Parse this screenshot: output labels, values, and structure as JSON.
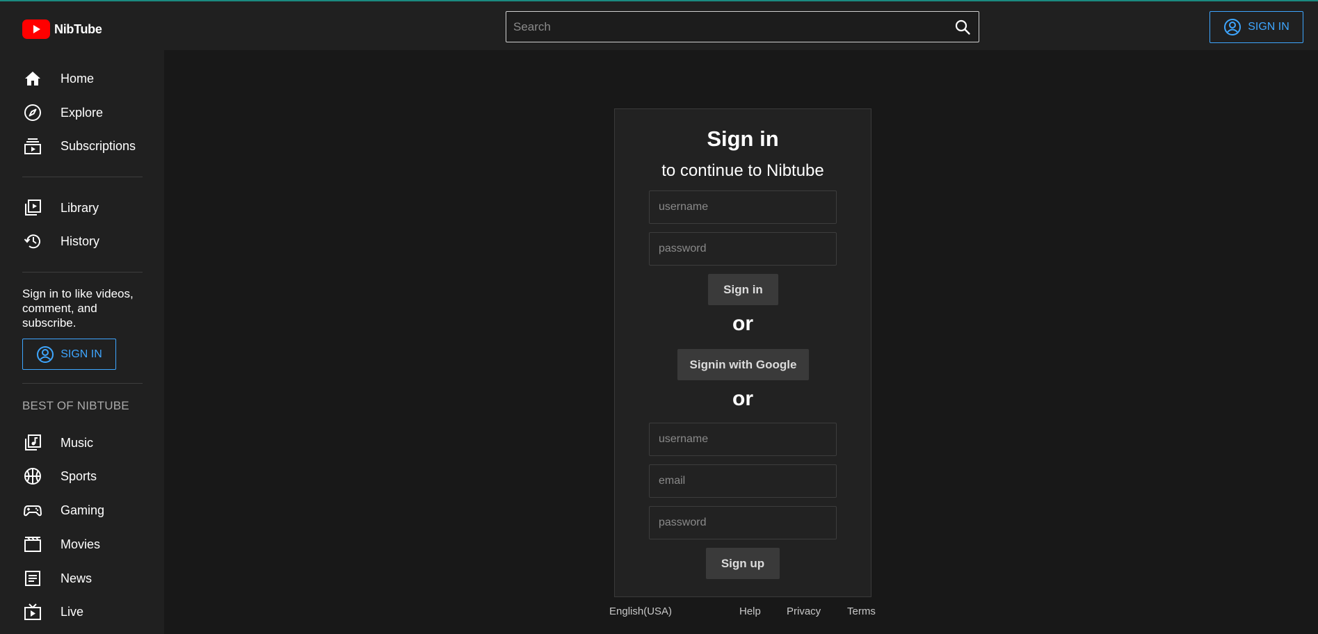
{
  "app": {
    "name": "NibTube"
  },
  "header": {
    "search_placeholder": "Search",
    "signin_label": "SIGN IN"
  },
  "sidebar": {
    "primary": [
      {
        "label": "Home",
        "icon": "home-icon"
      },
      {
        "label": "Explore",
        "icon": "compass-icon"
      },
      {
        "label": "Subscriptions",
        "icon": "subscriptions-icon"
      }
    ],
    "secondary": [
      {
        "label": "Library",
        "icon": "library-icon"
      },
      {
        "label": "History",
        "icon": "history-icon"
      }
    ],
    "signin_message": "Sign in to like videos, comment, and subscribe.",
    "signin_label": "SIGN IN",
    "section_title": "BEST OF NIBTUBE",
    "best": [
      {
        "label": "Music",
        "icon": "music-icon"
      },
      {
        "label": "Sports",
        "icon": "sports-icon"
      },
      {
        "label": "Gaming",
        "icon": "gaming-icon"
      },
      {
        "label": "Movies",
        "icon": "movies-icon"
      },
      {
        "label": "News",
        "icon": "news-icon"
      },
      {
        "label": "Live",
        "icon": "live-icon"
      }
    ]
  },
  "signin_card": {
    "title": "Sign in",
    "subtitle": "to continue to Nibtube",
    "login": {
      "username_placeholder": "username",
      "password_placeholder": "password",
      "submit_label": "Sign in"
    },
    "or_1": "or",
    "google_label": "Signin with Google",
    "or_2": "or",
    "signup": {
      "username_placeholder": "username",
      "email_placeholder": "email",
      "password_placeholder": "password",
      "submit_label": "Sign up"
    }
  },
  "footer": {
    "language": "English(USA)",
    "help": "Help",
    "privacy": "Privacy",
    "terms": "Terms"
  },
  "colors": {
    "accent": "#3ea6ff",
    "brand": "#ff0000",
    "background": "#181818",
    "surface": "#202020"
  }
}
